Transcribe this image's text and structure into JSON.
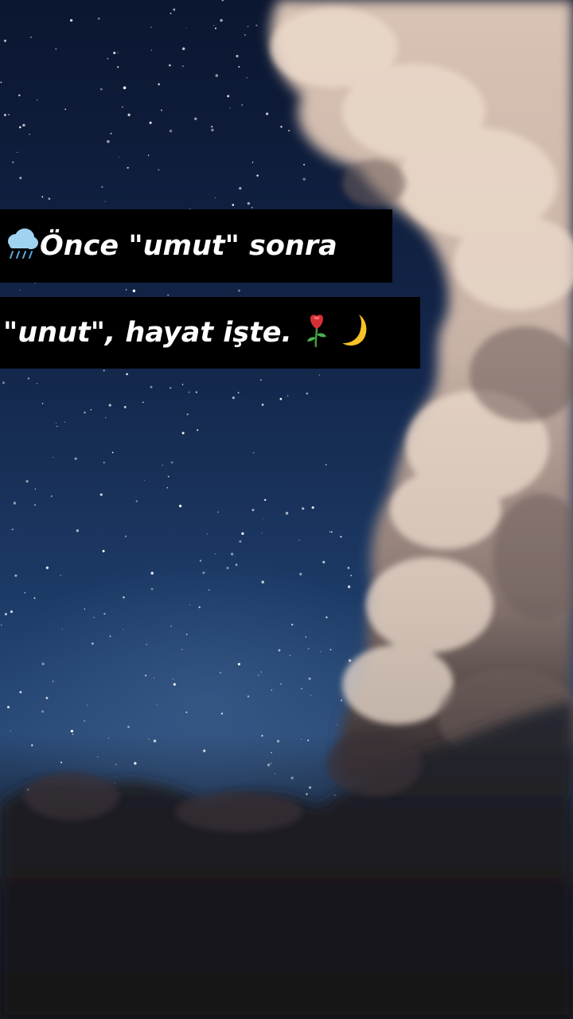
{
  "caption": {
    "line1": "Önce \"umut\" sonra",
    "line2": "\"unut\",  hayat işte."
  },
  "icons": {
    "line1_leading": "cloud-with-rain-icon",
    "line2_trailing": [
      "rose-icon",
      "crescent-moon-icon"
    ]
  },
  "colors": {
    "sky_top": "#0b1630",
    "sky_mid": "#1c3a66",
    "cloud_light": "#e8d4c4",
    "cloud_shadow": "#7a6660",
    "caption_background": "#000000",
    "caption_text": "#ffffff"
  }
}
